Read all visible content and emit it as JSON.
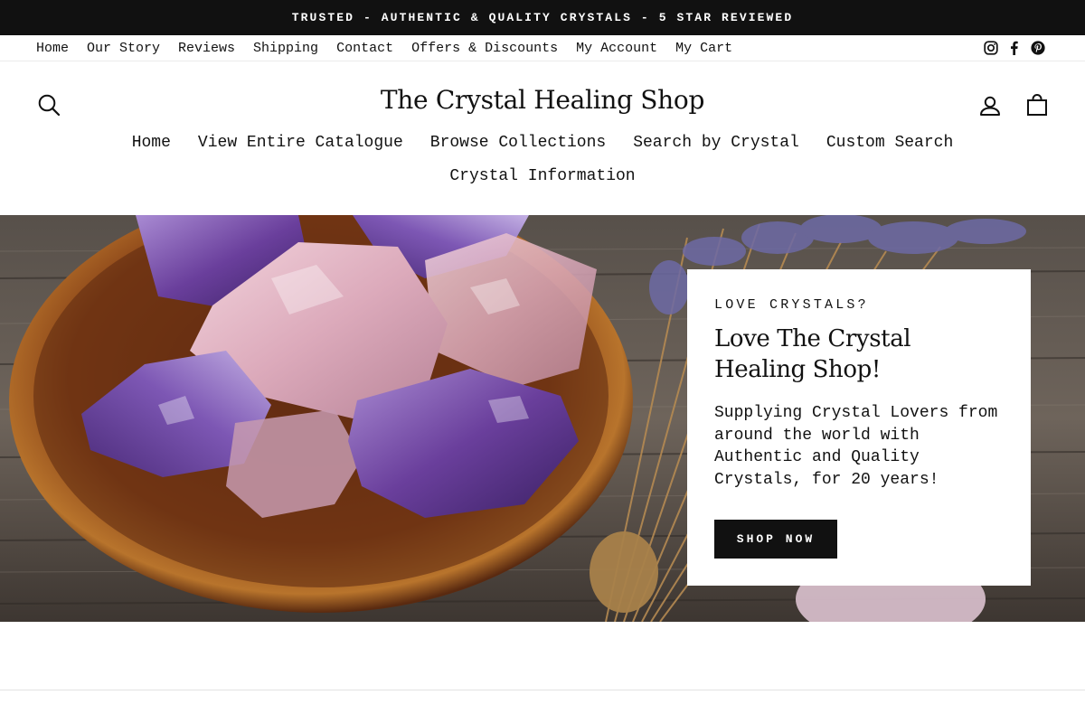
{
  "announcement": "TRUSTED - AUTHENTIC & QUALITY CRYSTALS - 5 STAR REVIEWED",
  "utility_links": [
    "Home",
    "Our Story",
    "Reviews",
    "Shipping",
    "Contact",
    "Offers & Discounts",
    "My Account",
    "My Cart"
  ],
  "social_icons": [
    "instagram-icon",
    "facebook-icon",
    "pinterest-icon"
  ],
  "header": {
    "logo": "The Crystal Healing Shop",
    "icons": [
      "search-icon",
      "account-icon",
      "cart-bag-icon"
    ]
  },
  "main_nav": [
    "Home",
    "View Entire Catalogue",
    "Browse Collections",
    "Search by Crystal",
    "Custom Search",
    "Crystal Information"
  ],
  "hero": {
    "eyebrow": "LOVE CRYSTALS?",
    "title": "Love The Crystal Healing Shop!",
    "text": "Supplying Crystal Lovers from around the world with Authentic and Quality Crystals, for 20 years!",
    "button": "SHOP NOW"
  },
  "colors": {
    "announcement_bg": "#111111",
    "button_bg": "#111111",
    "text": "#111111",
    "amethyst": "#7b4fa8",
    "rose_quartz": "#e2b3c3"
  }
}
